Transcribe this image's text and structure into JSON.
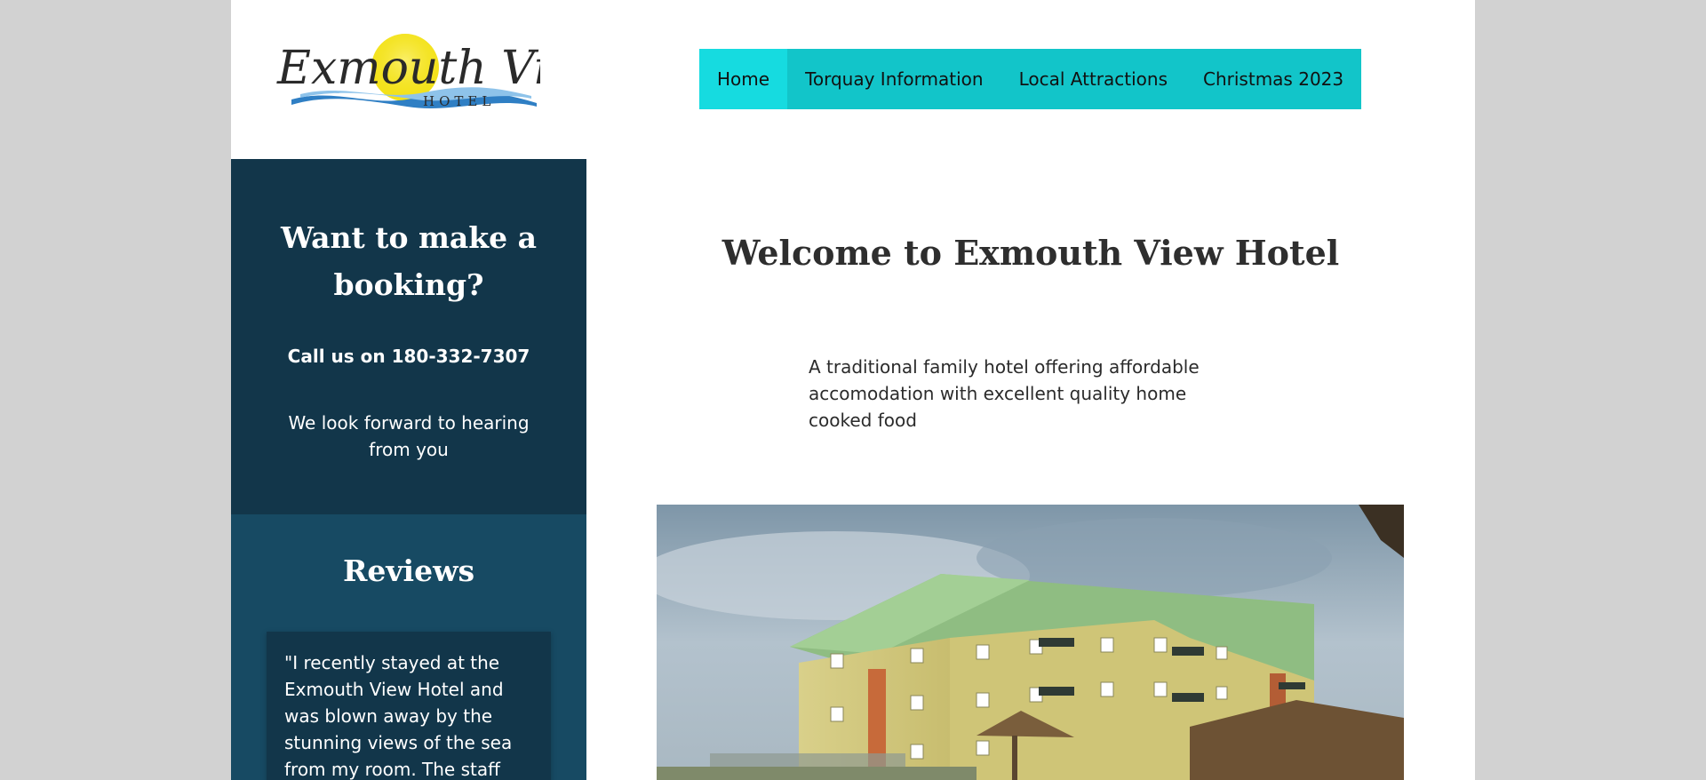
{
  "logo": {
    "name": "Exmouth View",
    "subtitle": "HOTEL"
  },
  "nav": {
    "items": [
      {
        "label": "Home"
      },
      {
        "label": "Torquay Information"
      },
      {
        "label": "Local Attractions"
      },
      {
        "label": "Christmas 2023"
      }
    ]
  },
  "sidebar": {
    "booking": {
      "title": "Want to make a booking?",
      "phone": "Call us on 180-332-7307",
      "note": "We look forward to hearing from you"
    },
    "reviews": {
      "title": "Reviews",
      "quote": "\"I recently stayed at the Exmouth View Hotel and was blown away by the stunning views of the sea from my room. The staff"
    }
  },
  "main": {
    "title": "Welcome to Exmouth View Hotel",
    "intro": "A traditional family hotel offering affordable accomodation with excellent quality home cooked food"
  },
  "colors": {
    "nav_bg": "#12c5c9",
    "nav_active": "#16dbe0",
    "sidebar_dark": "#12364a",
    "sidebar_mid": "#174a63",
    "page_bg": "#d2d2d2"
  }
}
